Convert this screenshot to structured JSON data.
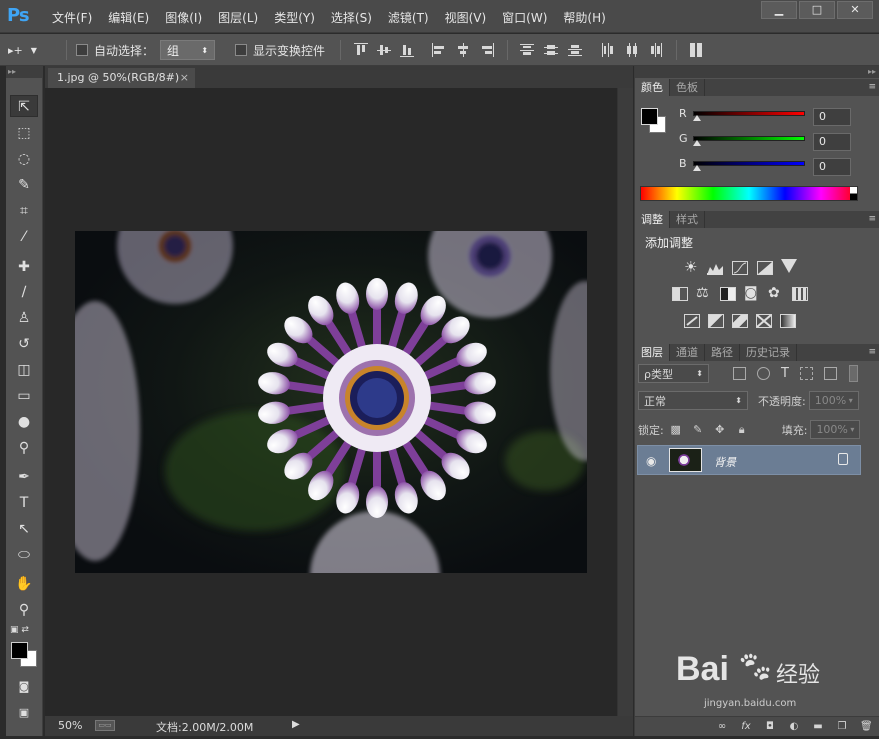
{
  "app": {
    "logo": "Ps"
  },
  "menu": [
    "文件(F)",
    "编辑(E)",
    "图像(I)",
    "图层(L)",
    "类型(Y)",
    "选择(S)",
    "滤镜(T)",
    "视图(V)",
    "窗口(W)",
    "帮助(H)"
  ],
  "window_controls": {
    "minimize": "▁",
    "maximize": "□",
    "close": "✕"
  },
  "options": {
    "move_tool": "▸+",
    "auto_select_label": "自动选择：",
    "auto_select_value": "组",
    "show_transform_label": "显示变换控件"
  },
  "document": {
    "tab_title": "1.jpg @ 50%(RGB/8#)",
    "tab_close": "×",
    "zoom": "50%",
    "doc_size": "文档:2.00M/2.00M",
    "status_arrow": "▶"
  },
  "color_panel": {
    "tabs": [
      "颜色",
      "色板"
    ],
    "r_label": "R",
    "g_label": "G",
    "b_label": "B",
    "r_value": "0",
    "g_value": "0",
    "b_value": "0",
    "foreground": "#000000",
    "background": "#ffffff"
  },
  "adjust_panel": {
    "tabs": [
      "调整",
      "样式"
    ],
    "title": "添加调整"
  },
  "layers_panel": {
    "tabs": [
      "图层",
      "通道",
      "路径",
      "历史记录"
    ],
    "filter_kind": "ρ类型",
    "blend_mode": "正常",
    "opacity_label": "不透明度:",
    "opacity_value": "100%",
    "lock_label": "锁定:",
    "fill_label": "填充:",
    "fill_value": "100%",
    "layer_name": "背景"
  },
  "watermark": {
    "text": "Bai",
    "brand_cn": "经验",
    "url": "jingyan.baidu.com"
  },
  "colors": {
    "accent": "#3fa5f5",
    "selected_layer": "#6b7d94",
    "panel_bg": "#535353",
    "canvas_bg": "#282828"
  }
}
